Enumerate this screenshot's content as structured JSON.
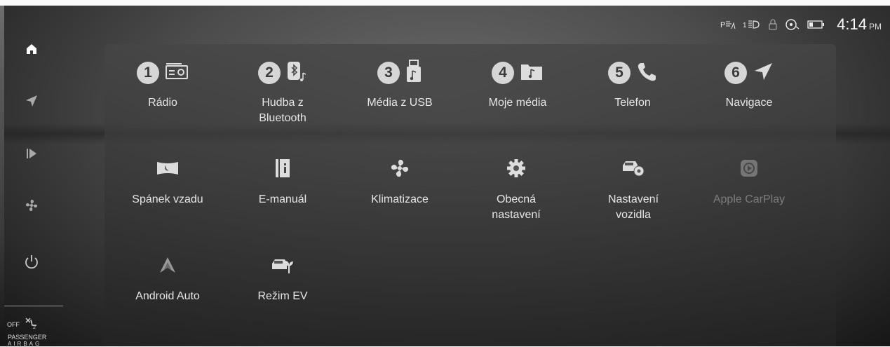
{
  "status": {
    "time": "4:14",
    "ampm": "PM",
    "icons": [
      "parking-sensor-icon",
      "headlight-level-icon",
      "lock-icon",
      "driver-assist-icon",
      "battery-icon"
    ]
  },
  "sidebar": {
    "items": [
      "home-icon",
      "navigation-icon",
      "media-play-icon",
      "fan-icon",
      "power-icon"
    ],
    "airbag": {
      "off": "OFF",
      "line1": "PASSENGER",
      "line2": "AIRBAG"
    }
  },
  "tiles": [
    {
      "badge": "1",
      "label": "Rádio",
      "icon": "radio-icon"
    },
    {
      "badge": "2",
      "label": "Hudba z Bluetooth",
      "icon": "bluetooth-music-icon"
    },
    {
      "badge": "3",
      "label": "Média z USB",
      "icon": "usb-media-icon"
    },
    {
      "badge": "4",
      "label": "Moje média",
      "icon": "my-media-folder-icon"
    },
    {
      "badge": "5",
      "label": "Telefon",
      "icon": "phone-icon"
    },
    {
      "badge": "6",
      "label": "Navigace",
      "icon": "navigation-arrow-icon"
    },
    {
      "label": "Spánek vzadu",
      "icon": "rear-sleep-icon"
    },
    {
      "label": "E-manuál",
      "icon": "e-manual-icon"
    },
    {
      "label": "Klimatizace",
      "icon": "climate-fan-icon"
    },
    {
      "label": "Obecná nastavení",
      "icon": "gear-icon"
    },
    {
      "label": "Nastavení vozidla",
      "icon": "vehicle-settings-icon"
    },
    {
      "label": "Apple CarPlay",
      "icon": "apple-carplay-icon",
      "disabled": true
    },
    {
      "label": "Android Auto",
      "icon": "android-auto-icon"
    },
    {
      "label": "Režim EV",
      "icon": "ev-mode-icon"
    }
  ]
}
